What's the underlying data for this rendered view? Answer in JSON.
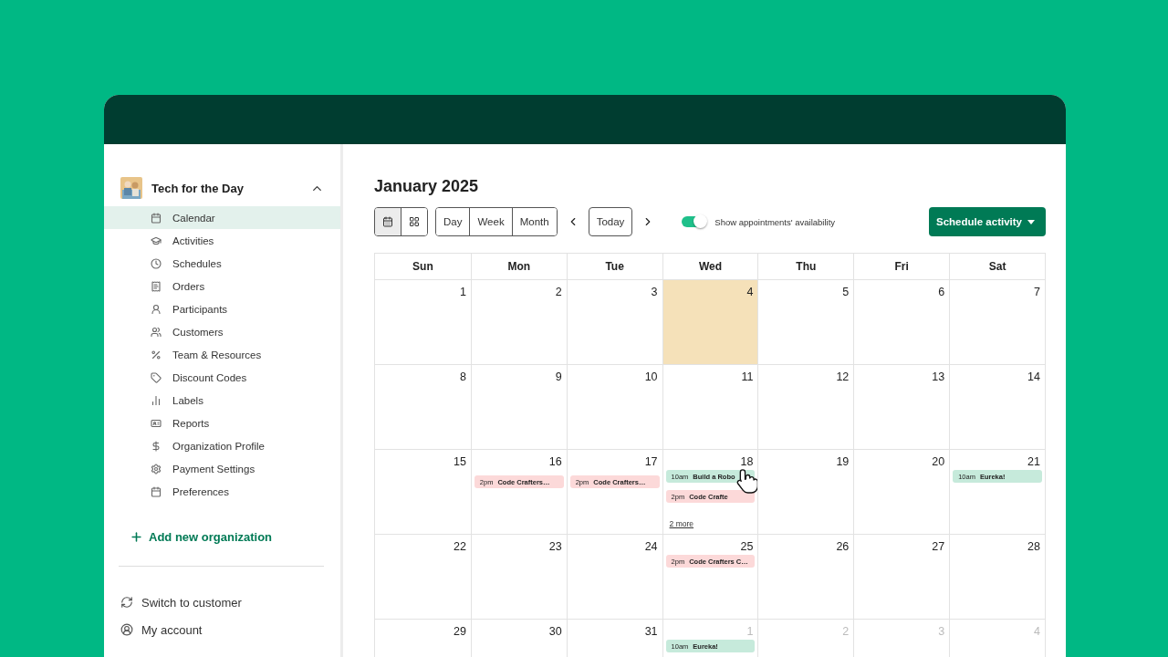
{
  "sidebar": {
    "organization": {
      "name": "Tech for the Day",
      "expanded": true
    },
    "items": [
      {
        "label": "Calendar",
        "selected": true
      },
      {
        "label": "Activities",
        "selected": false
      },
      {
        "label": "Schedules",
        "selected": false
      },
      {
        "label": "Orders",
        "selected": false
      },
      {
        "label": "Participants",
        "selected": false
      },
      {
        "label": "Customers",
        "selected": false
      },
      {
        "label": "Team & Resources",
        "selected": false
      },
      {
        "label": "Discount Codes",
        "selected": false
      },
      {
        "label": "Labels",
        "selected": false
      },
      {
        "label": "Reports",
        "selected": false
      },
      {
        "label": "Organization Profile",
        "selected": false
      },
      {
        "label": "Payment Settings",
        "selected": false
      },
      {
        "label": "Preferences",
        "selected": false
      }
    ],
    "add_organization": "Add new organization",
    "footer": [
      "Switch to customer",
      "My account"
    ]
  },
  "calendar": {
    "title": "January 2025",
    "layout_toggle": [
      {
        "selected": true
      },
      {
        "selected": false
      }
    ],
    "views": [
      "Day",
      "Week",
      "Month"
    ],
    "today_button": "Today",
    "availability_toggle": {
      "label": "Show appointments' availability",
      "on": true
    },
    "schedule_button": "Schedule activity",
    "weekdays": [
      "Sun",
      "Mon",
      "Tue",
      "Wed",
      "Thu",
      "Fri",
      "Sat"
    ],
    "weeks": [
      [
        {
          "day": "1",
          "muted": false,
          "today": false
        },
        {
          "day": "2",
          "muted": false,
          "today": false
        },
        {
          "day": "3",
          "muted": false,
          "today": false
        },
        {
          "day": "4",
          "muted": false,
          "today": true
        },
        {
          "day": "5",
          "muted": false,
          "today": false
        },
        {
          "day": "6",
          "muted": false,
          "today": false
        },
        {
          "day": "7",
          "muted": false,
          "today": false
        }
      ],
      [
        {
          "day": "8",
          "muted": false,
          "today": false
        },
        {
          "day": "9",
          "muted": false,
          "today": false
        },
        {
          "day": "10",
          "muted": false,
          "today": false
        },
        {
          "day": "11",
          "muted": false,
          "today": false
        },
        {
          "day": "12",
          "muted": false,
          "today": false
        },
        {
          "day": "13",
          "muted": false,
          "today": false
        },
        {
          "day": "14",
          "muted": false,
          "today": false
        }
      ],
      [
        {
          "day": "15",
          "muted": false,
          "today": false
        },
        {
          "day": "16",
          "muted": false,
          "today": false,
          "events": [
            {
              "time": "2pm",
              "title": "Code Crafters…",
              "color": "#fcd9d9"
            }
          ]
        },
        {
          "day": "17",
          "muted": false,
          "today": false,
          "events": [
            {
              "time": "2pm",
              "title": "Code Crafters…",
              "color": "#fcd9d9"
            }
          ]
        },
        {
          "day": "18",
          "muted": false,
          "today": false,
          "events": [
            {
              "time": "10am",
              "title": "Build a Robo",
              "color": "#c6eadb"
            },
            {
              "time": "2pm",
              "title": "Code Crafte",
              "color": "#fcd9d9"
            }
          ],
          "more": "2 more"
        },
        {
          "day": "19",
          "muted": false,
          "today": false
        },
        {
          "day": "20",
          "muted": false,
          "today": false
        },
        {
          "day": "21",
          "muted": false,
          "today": false,
          "events": [
            {
              "time": "10am",
              "title": "Eureka!",
              "color": "#c6eadb"
            }
          ]
        }
      ],
      [
        {
          "day": "22",
          "muted": false,
          "today": false
        },
        {
          "day": "23",
          "muted": false,
          "today": false
        },
        {
          "day": "24",
          "muted": false,
          "today": false
        },
        {
          "day": "25",
          "muted": false,
          "today": false,
          "events": [
            {
              "time": "2pm",
              "title": "Code Crafters C…",
              "color": "#fcd9d9"
            }
          ]
        },
        {
          "day": "26",
          "muted": false,
          "today": false
        },
        {
          "day": "27",
          "muted": false,
          "today": false
        },
        {
          "day": "28",
          "muted": false,
          "today": false
        }
      ],
      [
        {
          "day": "29",
          "muted": false,
          "today": false
        },
        {
          "day": "30",
          "muted": false,
          "today": false
        },
        {
          "day": "31",
          "muted": false,
          "today": false
        },
        {
          "day": "1",
          "muted": true,
          "today": false,
          "events": [
            {
              "time": "10am",
              "title": "Eureka!",
              "color": "#c6eadb"
            }
          ]
        },
        {
          "day": "2",
          "muted": true,
          "today": false
        },
        {
          "day": "3",
          "muted": true,
          "today": false
        },
        {
          "day": "4",
          "muted": true,
          "today": false
        }
      ]
    ]
  }
}
